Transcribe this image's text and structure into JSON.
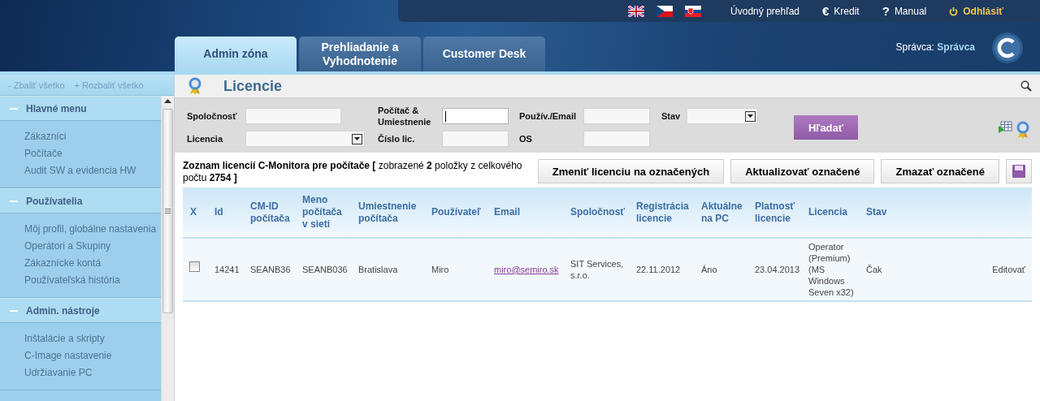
{
  "top_links": [
    {
      "kind": "home",
      "label": "Úvodný prehľad"
    },
    {
      "kind": "credit",
      "icon": "€",
      "label": "Kredit"
    },
    {
      "kind": "help",
      "icon": "?",
      "label": "Manual"
    },
    {
      "kind": "logout",
      "label": "Odhlásiť"
    }
  ],
  "tabs": [
    {
      "label": "Admin zóna",
      "selected": true
    },
    {
      "label": "Prehliadanie a Vyhodnotenie",
      "selected": false
    },
    {
      "label": "Customer Desk",
      "selected": false
    }
  ],
  "user": {
    "label": "Správca:",
    "name": "Správca"
  },
  "sidebar": {
    "collapse_all": "- Zbaliť všetko",
    "expand_all": "+ Rozbaliť všetko",
    "sections": [
      {
        "title": "Hlavné menu",
        "expanded": true,
        "items": [
          "Zákazníci",
          "Počítače",
          "Audit SW a evidencia HW"
        ]
      },
      {
        "title": "Používatelia",
        "expanded": true,
        "items": [
          "Môj profil, globálne nastavenia",
          "Operátori a Skupiny",
          "Zákaznícke kontá",
          "Používateľská história"
        ]
      },
      {
        "title": "Admin. nástroje",
        "expanded": true,
        "items": [
          "Inštalácie a skripty",
          "C-Image nastavenie",
          "Udržiavanie PC"
        ]
      }
    ]
  },
  "page_title": "Licencie",
  "filters": [
    {
      "label": "Spoločnosť",
      "kind": "text",
      "focused": false
    },
    {
      "label": "Počítač & Umiestnenie",
      "kind": "text",
      "focused": true
    },
    {
      "label": "Použív./Email",
      "kind": "text",
      "focused": false
    },
    {
      "label": "Stav",
      "kind": "select",
      "focused": false
    },
    {
      "label": "Licencia",
      "kind": "select",
      "focused": false
    },
    {
      "label": "Číslo lic.",
      "kind": "text",
      "focused": false
    },
    {
      "label": "OS",
      "kind": "text",
      "focused": false
    }
  ],
  "search_button": "Hľadať",
  "list_summary": "**Zoznam licencií C-Monitora pre počítače [** zobrazené **2** položky z celkového počtu **2754 ]**",
  "actions": [
    "Zmeniť licenciu na označených",
    "Aktualizovať označené",
    "Zmazať označené"
  ],
  "table": {
    "columns": [
      "X",
      "Id",
      "CM-ID počítača",
      "Meno počítača v sieti",
      "Umiestnenie počítača",
      "Používateľ",
      "Email",
      "Spoločnosť",
      "Registrácia licencie",
      "Aktuálne na PC",
      "Platnosť licencie",
      "Licencia",
      "Stav"
    ],
    "rows": [
      {
        "cells": [
          {
            "kind": "checkbox",
            "checked": false
          },
          "14241",
          "SEANB36",
          "SEANB036",
          "Bratislava",
          "Miro",
          "miro@semiro.sk",
          "SIT Services, s.r.o.",
          "22.11.2012",
          "Áno",
          "23.04.2013",
          "Operator (Premium) (MS Windows Seven x32)",
          "Čak"
        ],
        "action": "Editovať"
      }
    ]
  }
}
